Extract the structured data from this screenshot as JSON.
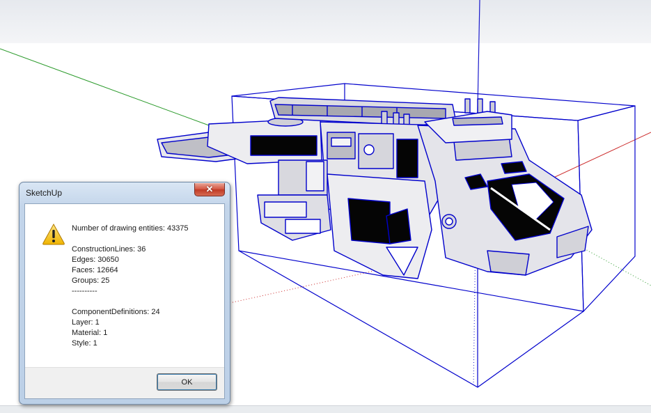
{
  "viewport": {
    "name": "3d-model-viewport"
  },
  "dialog": {
    "title": "SketchUp",
    "close_label": "✕",
    "icon": "warning-icon",
    "lines": {
      "entities": "Number of drawing entities: 43375",
      "construction_lines": "ConstructionLines: 36",
      "edges": "Edges: 30650",
      "faces": "Faces: 12664",
      "groups": "Groups: 25",
      "separator": "----------",
      "component_definitions": "ComponentDefinitions: 24",
      "layer": "Layer: 1",
      "material": "Material: 1",
      "style": "Style: 1"
    },
    "ok_label": "OK"
  },
  "colors": {
    "selection_blue": "#0000cc",
    "axis_green": "#2a9a2a",
    "axis_red": "#cc2a2a",
    "axis_blue": "#1a1acc"
  }
}
